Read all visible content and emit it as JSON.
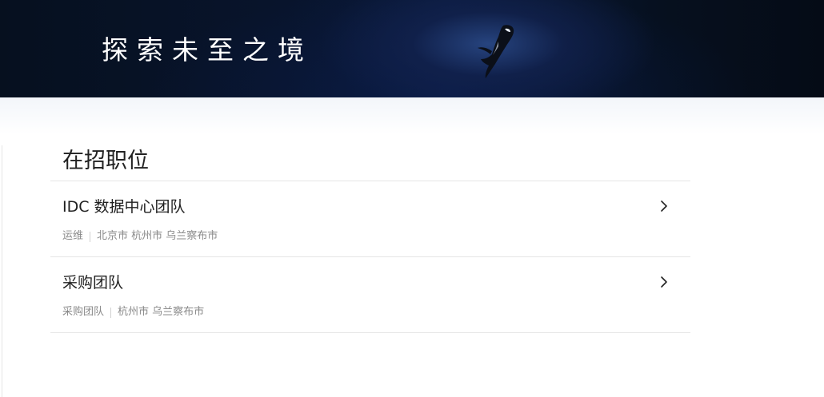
{
  "banner": {
    "title": "探索未至之境",
    "image": "orca-underwater"
  },
  "positions": {
    "heading": "在招职位",
    "jobs": [
      {
        "name": "IDC 数据中心团队",
        "category": "运维",
        "locations": "北京市 杭州市 乌兰察布市",
        "arrow_icon": "chevron-right-icon"
      },
      {
        "name": "采购团队",
        "category": "采购团队",
        "locations": "杭州市 乌兰察布市",
        "arrow_icon": "chevron-right-icon"
      }
    ]
  },
  "colors": {
    "banner_dark": "#06101f",
    "banner_glow": "#284682",
    "text_primary": "#1f1f1f",
    "text_secondary": "#8a8a8a",
    "divider": "#e6e6e6"
  }
}
